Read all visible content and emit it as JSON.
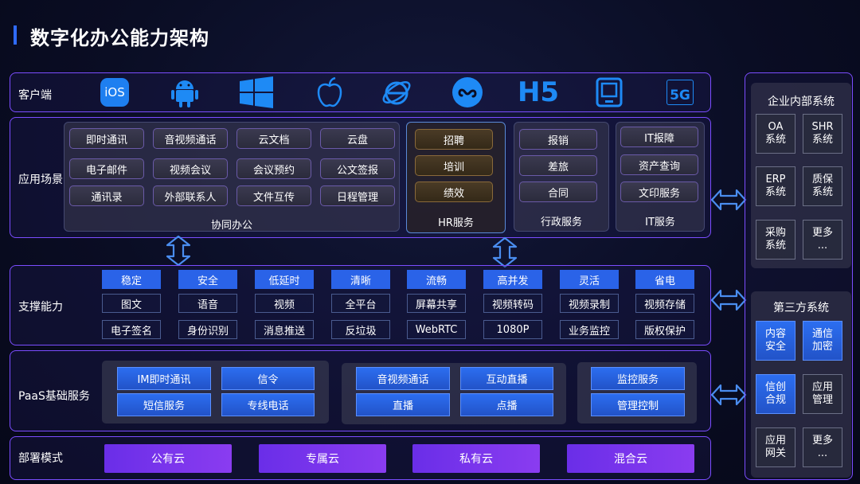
{
  "title": "数字化办公能力架构",
  "rows": {
    "client": "客户端",
    "app": "应用场景",
    "support": "支撑能力",
    "paas": "PaaS基础服务",
    "deploy": "部署模式"
  },
  "client_icons": [
    {
      "name": "ios-icon",
      "text": "iOS"
    },
    {
      "name": "android-icon"
    },
    {
      "name": "windows-icon"
    },
    {
      "name": "apple-icon"
    },
    {
      "name": "ie-browser-icon"
    },
    {
      "name": "mini-program-icon"
    },
    {
      "name": "h5-icon",
      "text": "H5"
    },
    {
      "name": "terminal-device-icon"
    },
    {
      "name": "5g-icon",
      "text": "5G"
    }
  ],
  "collab": {
    "label": "协同办公",
    "items": [
      "即时通讯",
      "音视频通话",
      "云文档",
      "云盘",
      "电子邮件",
      "视频会议",
      "会议预约",
      "公文签报",
      "通讯录",
      "外部联系人",
      "文件互传",
      "日程管理"
    ]
  },
  "hr": {
    "label": "HR服务",
    "items": [
      "招聘",
      "培训",
      "绩效"
    ]
  },
  "admin": {
    "label": "行政服务",
    "items": [
      "报销",
      "差旅",
      "合同"
    ]
  },
  "it": {
    "label": "IT服务",
    "items": [
      "IT报障",
      "资产查询",
      "文印服务"
    ]
  },
  "support": {
    "keywords": [
      "稳定",
      "安全",
      "低延时",
      "清晰",
      "流畅",
      "高并发",
      "灵活",
      "省电"
    ],
    "row1": [
      "图文",
      "语音",
      "视频",
      "全平台",
      "屏幕共享",
      "视频转码",
      "视频录制",
      "视频存储"
    ],
    "row2": [
      "电子签名",
      "身份识别",
      "消息推送",
      "反垃圾",
      "WebRTC",
      "1080P",
      "业务监控",
      "版权保护"
    ]
  },
  "paas": {
    "group1": [
      "IM即时通讯",
      "信令",
      "短信服务",
      "专线电话"
    ],
    "group2": [
      "音视频通话",
      "互动直播",
      "直播",
      "点播"
    ],
    "group3": [
      "监控服务",
      "管理控制"
    ]
  },
  "deploy": [
    "公有云",
    "专属云",
    "私有云",
    "混合云"
  ],
  "internal": {
    "label": "企业内部系统",
    "items": [
      "OA\n系统",
      "SHR\n系统",
      "ERP\n系统",
      "质保\n系统",
      "采购\n系统",
      "更多\n..."
    ]
  },
  "third": {
    "label": "第三方系统",
    "items": [
      "内容\n安全",
      "通信\n加密",
      "信创\n合规",
      "应用\n管理",
      "应用\n网关",
      "更多\n..."
    ]
  },
  "colors": {
    "accent_blue": "#2a63e8",
    "border_purple": "#7b4dff",
    "deploy_purple": "#7a36ee"
  }
}
